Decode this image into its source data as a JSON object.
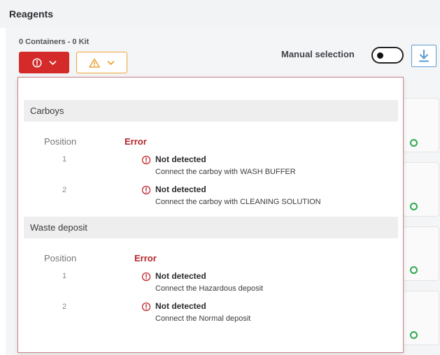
{
  "header": {
    "title": "Reagents"
  },
  "toolbar": {
    "summary": "0 Containers - 0 Kit",
    "manual_selection_label": "Manual selection",
    "manual_selection_on": false
  },
  "colors": {
    "error": "#d42a2a",
    "warning": "#e9a232",
    "accent": "#5b9bd5",
    "ok": "#2fa84f"
  },
  "icons": {
    "error_filter": "error-circle-icon",
    "warning_filter": "warning-triangle-icon",
    "chevron": "chevron-down-icon",
    "download": "download-icon",
    "row_status": "error-circle-icon"
  },
  "dropdown": {
    "sections": [
      {
        "title": "Carboys",
        "position_header": "Position",
        "error_header": "Error",
        "rows": [
          {
            "position": "1",
            "title": "Not detected",
            "description": "Connect the carboy with WASH BUFFER"
          },
          {
            "position": "2",
            "title": "Not detected",
            "description": "Connect the carboy with CLEANING SOLUTION"
          }
        ]
      },
      {
        "title": "Waste deposit",
        "position_header": "Position",
        "error_header": "Error",
        "rows": [
          {
            "position": "1",
            "title": "Not detected",
            "description": "Connect the Hazardous deposit"
          },
          {
            "position": "2",
            "title": "Not detected",
            "description": "Connect the Normal deposit"
          }
        ]
      }
    ]
  }
}
